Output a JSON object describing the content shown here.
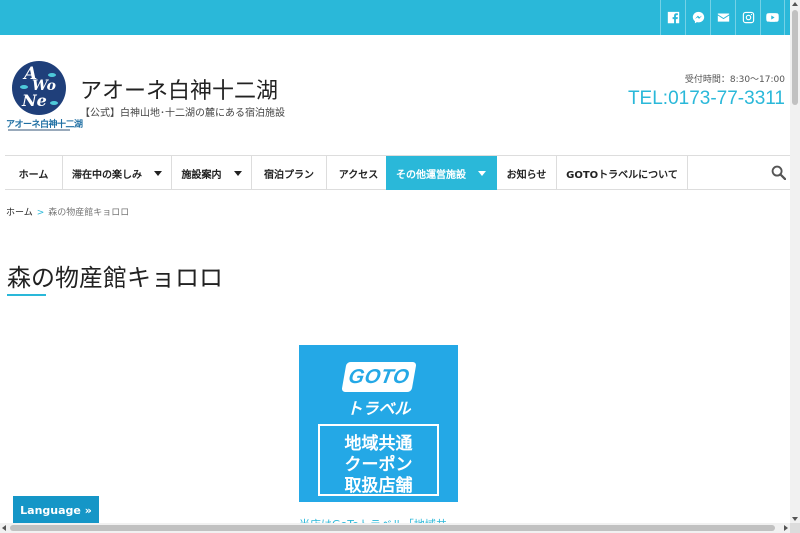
{
  "topbar": {
    "color": "#2ab8d9",
    "social": [
      {
        "icon": "facebook-icon"
      },
      {
        "icon": "messenger-icon"
      },
      {
        "icon": "mail-icon"
      },
      {
        "icon": "instagram-icon"
      },
      {
        "icon": "youtube-icon"
      }
    ]
  },
  "header": {
    "logo_letters": [
      "A",
      "Wo",
      "Ne"
    ],
    "logo_caption": "アオーネ白神十二湖",
    "title": "アオーネ白神十二湖",
    "description": "【公式】白神山地･十二湖の麓にある宿泊施設",
    "hours": "受付時間：8:30～17:00",
    "tel": "TEL:0173-77-3311"
  },
  "nav": {
    "items": [
      {
        "label": "ホーム",
        "dropdown": false,
        "active": false
      },
      {
        "label": "滞在中の楽しみ",
        "dropdown": true,
        "active": false
      },
      {
        "label": "施設案内",
        "dropdown": true,
        "active": false
      },
      {
        "label": "宿泊プラン",
        "dropdown": false,
        "active": false
      },
      {
        "label": "アクセス",
        "dropdown": false,
        "active": false
      },
      {
        "label": "その他運営施設",
        "dropdown": true,
        "active": true
      },
      {
        "label": "お知らせ",
        "dropdown": false,
        "active": false
      },
      {
        "label": "GOTOトラベルについて",
        "dropdown": false,
        "active": false
      }
    ],
    "search_icon": "search-icon"
  },
  "breadcrumb": {
    "home": "ホーム",
    "separator": ">",
    "current": "森の物産館キョロロ"
  },
  "page": {
    "title": "森の物産館キョロロ"
  },
  "banner": {
    "badge": "GOTO",
    "travel": "トラベル",
    "lines": [
      "地域共通",
      "クーポン",
      "取扱店舗"
    ],
    "color": "#24a8e6"
  },
  "caption": "当店はGoToトラベル「地域共",
  "language_button": "Language »"
}
